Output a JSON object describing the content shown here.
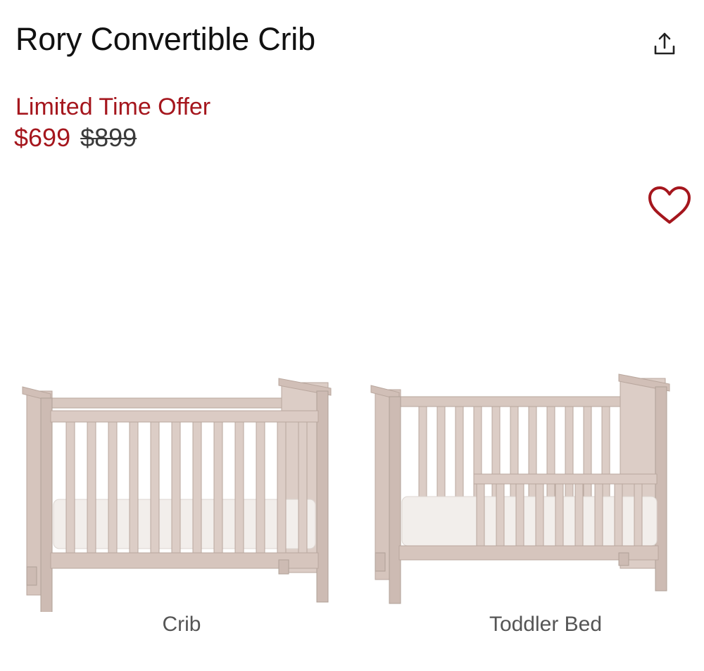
{
  "product": {
    "title": "Rory Convertible Crib",
    "promo_label": "Limited Time Offer",
    "sale_price": "$699",
    "original_price": "$899"
  },
  "icons": {
    "share": "share-icon",
    "favorite": "heart-outline-icon"
  },
  "colors": {
    "promo_red": "#a5161d",
    "wood": "#d8c8c0",
    "wood_dark": "#b9a79e",
    "mattress": "#f2eeeb"
  },
  "configurations": [
    {
      "label": "Crib"
    },
    {
      "label": "Toddler Bed"
    }
  ]
}
